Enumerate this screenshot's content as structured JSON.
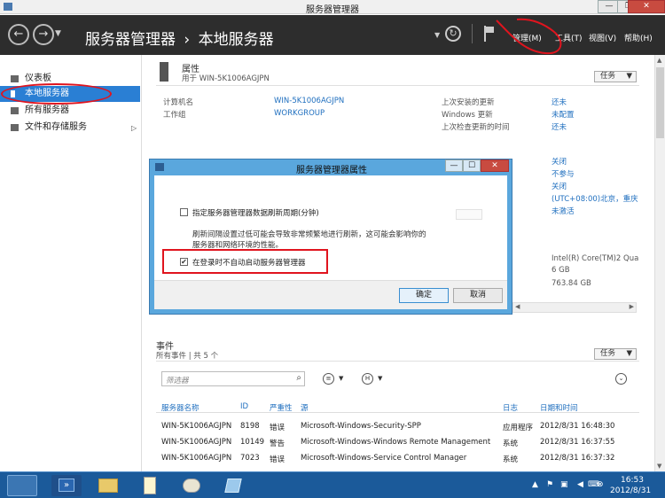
{
  "window": {
    "title": "服务器管理器",
    "controls": [
      "—",
      "❐",
      "✕"
    ]
  },
  "header": {
    "breadcrumb_root": "服务器管理器",
    "breadcrumb_sep": "›",
    "breadcrumb_current": "本地服务器",
    "menus": [
      "管理(M)",
      "工具(T)",
      "视图(V)",
      "帮助(H)"
    ]
  },
  "nav": {
    "items": [
      {
        "label": "仪表板"
      },
      {
        "label": "本地服务器"
      },
      {
        "label": "所有服务器"
      },
      {
        "label": "文件和存储服务"
      }
    ],
    "expand_glyph": "▷"
  },
  "properties": {
    "title": "属性",
    "subtitle": "用于 WIN-5K1006AGJPN",
    "tasks_label": "任务",
    "rows_left": [
      {
        "label": "计算机名",
        "value": "WIN-5K1006AGJPN"
      },
      {
        "label": "工作组",
        "value": "WORKGROUP"
      }
    ],
    "rows_right": [
      {
        "label": "上次安装的更新",
        "value": "还未"
      },
      {
        "label": "Windows 更新",
        "value": "未配置"
      },
      {
        "label": "上次检查更新的时间",
        "value": "还未"
      }
    ],
    "right_values_2": [
      "关闭",
      "不参与",
      "关闭",
      "(UTC+08:00)北京，重庆",
      "未激活"
    ],
    "right_values_3": [
      "Intel(R) Core(TM)2 Qua",
      "6 GB",
      "763.84 GB"
    ]
  },
  "dialog": {
    "title": "服务器管理器属性",
    "controls": [
      "—",
      "☐",
      "✕"
    ],
    "option1": "指定服务器管理器数据刷新周期(分钟)",
    "description_line1": "刷新间隔设置过低可能会导致非常频繁地进行刷新，这可能会影响你的",
    "description_line2": "服务器和网络环境的性能。",
    "option2": "在登录时不自动启动服务器管理器",
    "option2_checked": "✔",
    "ok": "确定",
    "cancel": "取消"
  },
  "events": {
    "title": "事件",
    "subtitle": "所有事件 | 共 5 个",
    "tasks_label": "任务",
    "filter_placeholder": "筛选器",
    "columns": [
      "服务器名称",
      "ID",
      "严重性",
      "源",
      "日志",
      "日期和时间"
    ],
    "rows": [
      [
        "WIN-5K1006AGJPN",
        "8198",
        "错误",
        "Microsoft-Windows-Security-SPP",
        "应用程序",
        "2012/8/31 16:48:30"
      ],
      [
        "WIN-5K1006AGJPN",
        "10149",
        "警告",
        "Microsoft-Windows-Windows Remote Management",
        "系统",
        "2012/8/31 16:37:55"
      ],
      [
        "WIN-5K1006AGJPN",
        "7023",
        "错误",
        "Microsoft-Windows-Service Control Manager",
        "系统",
        "2012/8/31 16:37:32"
      ]
    ]
  },
  "taskbar": {
    "time": "16:53",
    "date": "2012/8/31"
  },
  "colors": {
    "accent": "#2a7fd4",
    "header": "#2d2d2d",
    "dialog_frame": "#5aa7dd",
    "annotation": "#e0141e"
  }
}
